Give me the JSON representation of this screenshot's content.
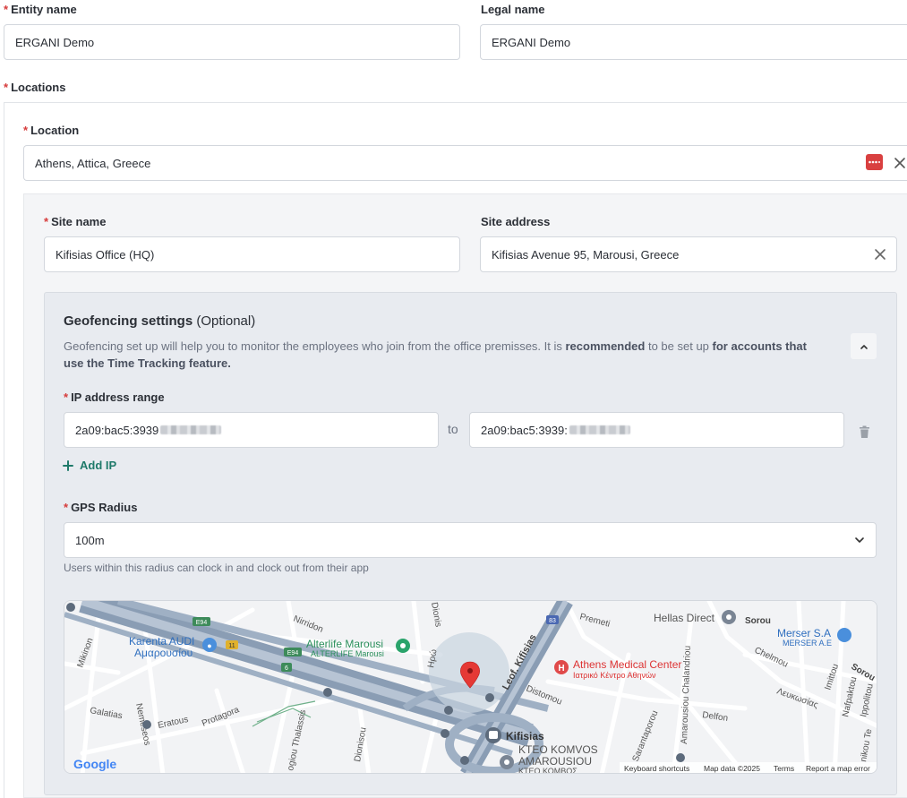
{
  "entity": {
    "entity_name_label": "Entity name",
    "entity_name_value": "ERGANI Demo",
    "legal_name_label": "Legal name",
    "legal_name_value": "ERGANI Demo"
  },
  "locations": {
    "section_label": "Locations",
    "location_label": "Location",
    "location_value": "Athens, Attica, Greece"
  },
  "site": {
    "site_name_label": "Site name",
    "site_name_value": "Kifisias Office (HQ)",
    "site_address_label": "Site address",
    "site_address_value": "Kifisias Avenue 95, Marousi, Greece"
  },
  "geofencing": {
    "title": "Geofencing settings",
    "title_optional": "(Optional)",
    "desc_part1": "Geofencing set up will help you to monitor the employees who join from the office premisses. It is ",
    "desc_bold1": "recommended",
    "desc_part2": " to be set up ",
    "desc_bold2": "for accounts that use the Time Tracking feature.",
    "ip_label": "IP address range",
    "ip_from": "2a09:bac5:3939",
    "ip_to": "2a09:bac5:3939:",
    "to_label": "to",
    "add_ip_label": "Add IP",
    "gps_label": "GPS Radius",
    "gps_value": "100m",
    "gps_help": "Users within this radius can clock in and clock out from their app"
  },
  "map": {
    "poi_karenta": "Karenta AUDI",
    "poi_karenta_gr": "Αμαρουσίου",
    "poi_alterlife": "Alterlife Marousi",
    "poi_alterlife_sub": "ALTERLIFE Marousi",
    "poi_athens_medical": "Athens Medical Center",
    "poi_athens_medical_gr": "Ιατρικό Κέντρο Αθηνών",
    "poi_hellas_direct": "Hellas Direct",
    "poi_merser": "Merser S.A",
    "poi_merser_sub": "MERSER A.E",
    "poi_kifisias": "Kifisias",
    "poi_ktel": "ΚΤΕΟ KOMVOS",
    "poi_ktel2": "AMAROUSIOU",
    "poi_ktel3": "ΚΤΕΟ ΚΟΜΒΟΣ",
    "st_nirridon": "Nirridon",
    "st_dionis": "Dionis",
    "st_premeti": "Premeti",
    "st_leof": "Leof. Kifisias",
    "st_sorou": "Sorou",
    "st_sorou2": "Sorou",
    "st_mikinon": "Mikinon",
    "st_nemeseos": "Nemeseos",
    "st_galatias": "Galatias",
    "st_eratous": "Eratous",
    "st_protagora": "Protagora",
    "st_thalassis": "ogiou Thalassis",
    "st_dionisou": "Dionisou",
    "st_distomou": "Distomou",
    "st_sarantaporou": "Sarantaporou",
    "st_amarousiou": "Amarousiou Chalandriou",
    "st_delfon": "Delfon",
    "st_chelmou": "Chelmou",
    "st_lefkosias": "Λευκωσίας",
    "st_imittou": "Imittou",
    "st_nafpaktou": "Nafpaktou",
    "st_ippolitou": "Ippolitou",
    "st_nikou": "nikou Te",
    "st_irodou": "Ηρώ",
    "badge_e94": "E94",
    "badge_e94b": "E94",
    "badge_11": "11",
    "badge_6": "6",
    "badge_83": "83",
    "google_logo": "Google",
    "footer_shortcuts": "Keyboard shortcuts",
    "footer_data": "Map data ©2025",
    "footer_terms": "Terms",
    "footer_report": "Report a map error"
  },
  "colors": {
    "required": "#d63b3b",
    "add_ip": "#1f7a6a",
    "map_pin": "#e53935"
  },
  "icons": {
    "password_manager": "password-manager-icon",
    "clear": "close-icon",
    "collapse": "chevron-up-icon",
    "delete": "trash-icon",
    "add": "plus-icon",
    "dropdown": "chevron-down-icon"
  }
}
